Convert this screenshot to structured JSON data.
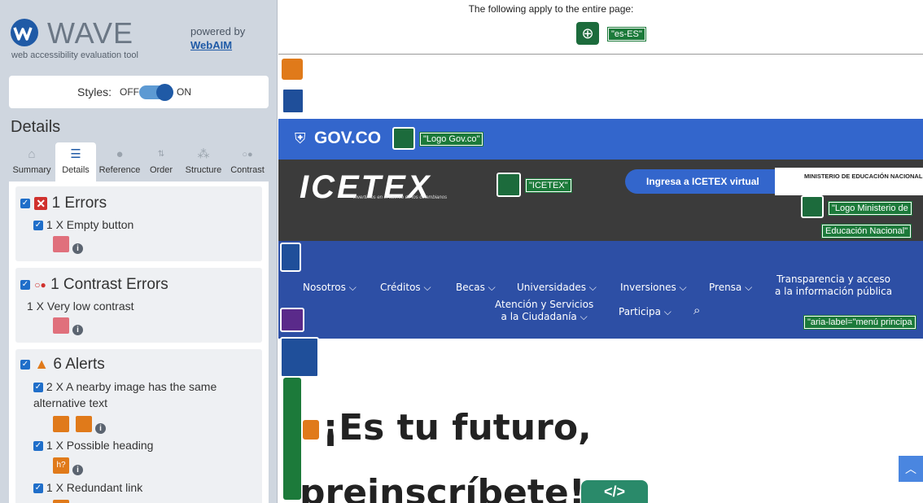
{
  "sidebar": {
    "brand_word": "WAVE",
    "brand_sub": "web accessibility evaluation tool",
    "powered_by": "powered by",
    "webaim_link": "WebAIM",
    "styles_label": "Styles:",
    "styles_off": "OFF",
    "styles_on": "ON",
    "details_heading": "Details",
    "tabs": [
      {
        "label": "Summary",
        "icon": "home-icon"
      },
      {
        "label": "Details",
        "icon": "list-icon"
      },
      {
        "label": "Reference",
        "icon": "info-icon"
      },
      {
        "label": "Order",
        "icon": "order-icon"
      },
      {
        "label": "Structure",
        "icon": "structure-icon"
      },
      {
        "label": "Contrast",
        "icon": "contrast-icon"
      }
    ],
    "sections": {
      "errors": {
        "title": "1 Errors",
        "items": [
          "1 X Empty button"
        ]
      },
      "contrast": {
        "title": "1 Contrast Errors",
        "items": [
          "1 X Very low contrast"
        ]
      },
      "alerts": {
        "title": "6 Alerts",
        "items": [
          "2 X A nearby image has the same alternative text",
          "1 X Possible heading",
          "1 X Redundant link"
        ]
      }
    }
  },
  "page": {
    "notice": "The following apply to the entire page:",
    "lang_label": "\"es-ES\"",
    "gov_text": "GOV.CO",
    "gov_logo_label": "\"Logo Gov.co\"",
    "icetex_label": "\"ICETEX\"",
    "icetex_tagline": "Invertimos en el talento de los colombianos",
    "ingresa": "Ingresa a ICETEX virtual",
    "ministerio": "MINISTERIO DE EDUCACIÓN NACIONAL",
    "ministerio_label_1": "\"Logo Ministerio de",
    "ministerio_label_2": "Educación Nacional\"",
    "nav": {
      "nosotros": "Nosotros ⌵",
      "creditos": "Créditos ⌵",
      "becas": "Becas ⌵",
      "universidades": "Universidades ⌵",
      "inversiones": "Inversiones ⌵",
      "prensa": "Prensa ⌵",
      "transparencia_1": "Transparencia y acceso",
      "transparencia_2": "a la información pública",
      "atencion_1": "Atención y Servicios",
      "atencion_2": "a la Ciudadanía ⌵",
      "participa": "Participa ⌵"
    },
    "aria_label": "\"aria-label=\"menú principa",
    "hero_title": "¡Es tu futuro,",
    "hero_line2": "preinscríbete!",
    "code_badge": "</>",
    "colors": {
      "gov_blue": "#3366cc",
      "nav_blue": "#2d4fa5",
      "wave_green": "#1c7a3a"
    }
  }
}
